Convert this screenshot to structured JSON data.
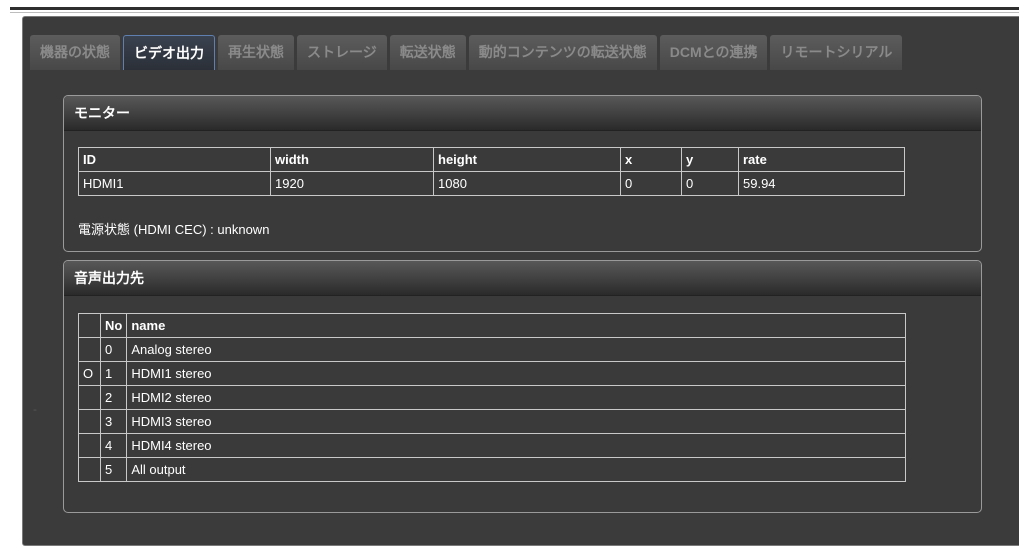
{
  "tabs": [
    {
      "label": "機器の状態",
      "active": false
    },
    {
      "label": "ビデオ出力",
      "active": true
    },
    {
      "label": "再生状態",
      "active": false
    },
    {
      "label": "ストレージ",
      "active": false
    },
    {
      "label": "転送状態",
      "active": false
    },
    {
      "label": "動的コンテンツの転送状態",
      "active": false
    },
    {
      "label": "DCMとの連携",
      "active": false
    },
    {
      "label": "リモートシリアル",
      "active": false
    }
  ],
  "monitor": {
    "title": "モニター",
    "headers": [
      "ID",
      "width",
      "height",
      "x",
      "y",
      "rate"
    ],
    "rows": [
      [
        "HDMI1",
        "1920",
        "1080",
        "0",
        "0",
        "59.94"
      ]
    ],
    "cec_label": "電源状態 (HDMI CEC) : unknown"
  },
  "audio": {
    "title": "音声出力先",
    "headers": [
      "",
      "No",
      "name"
    ],
    "rows": [
      [
        "",
        "0",
        "Analog stereo"
      ],
      [
        "O",
        "1",
        "HDMI1 stereo"
      ],
      [
        "",
        "2",
        "HDMI2 stereo"
      ],
      [
        "",
        "3",
        "HDMI3 stereo"
      ],
      [
        "",
        "4",
        "HDMI4 stereo"
      ],
      [
        "",
        "5",
        "All output"
      ]
    ]
  }
}
